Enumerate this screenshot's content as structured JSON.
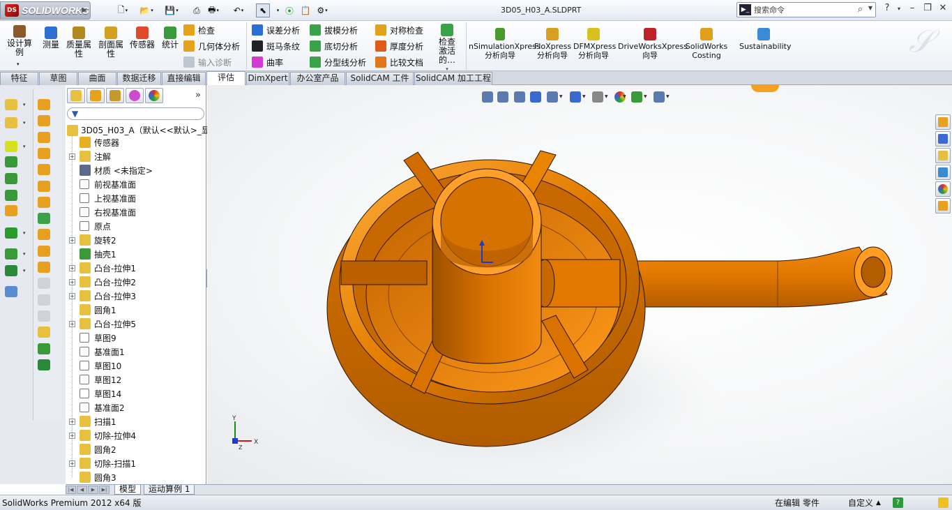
{
  "app": {
    "logo": "SOLIDWORKS",
    "file_title": "3D05_H03_A.SLDPRT"
  },
  "search": {
    "placeholder": "搜索命令"
  },
  "ribbon": {
    "big_buttons": [
      {
        "label": "设计算例",
        "icon": "design-study-icon",
        "color": "#8a5a2a"
      },
      {
        "label": "测量",
        "icon": "measure-icon",
        "color": "#2c6fd1"
      },
      {
        "label": "质量属性",
        "icon": "mass-properties-icon",
        "color": "#b08a1e"
      },
      {
        "label": "剖面属性",
        "icon": "section-properties-icon",
        "color": "#d4a020"
      },
      {
        "label": "传感器",
        "icon": "sensor-icon",
        "color": "#e04a2a"
      },
      {
        "label": "统计",
        "icon": "statistics-icon",
        "color": "#3a9a3a"
      }
    ],
    "small_col1": [
      {
        "label": "检查",
        "icon": "check-icon",
        "color": "#e6a21a"
      },
      {
        "label": "几何体分析",
        "icon": "geometry-analysis-icon",
        "color": "#e6a21a"
      },
      {
        "label": "输入诊断",
        "icon": "import-diagnostics-icon",
        "color": "#c0c6cf"
      }
    ],
    "small_col2": [
      {
        "label": "误差分析",
        "icon": "deviation-analysis-icon",
        "color": "#2a6ed8"
      },
      {
        "label": "斑马条纹",
        "icon": "zebra-stripes-icon",
        "color": "#222222"
      },
      {
        "label": "曲率",
        "icon": "curvature-icon",
        "color": "#d23ad4"
      }
    ],
    "small_col3": [
      {
        "label": "拔模分析",
        "icon": "draft-analysis-icon",
        "color": "#3aa34a"
      },
      {
        "label": "底切分析",
        "icon": "undercut-analysis-icon",
        "color": "#3aa34a"
      },
      {
        "label": "分型线分析",
        "icon": "parting-line-analysis-icon",
        "color": "#3aa34a"
      }
    ],
    "small_col4": [
      {
        "label": "对称检查",
        "icon": "symmetry-check-icon",
        "color": "#e0a31a"
      },
      {
        "label": "厚度分析",
        "icon": "thickness-analysis-icon",
        "color": "#e05a1a"
      },
      {
        "label": "比较文档",
        "icon": "compare-documents-icon",
        "color": "#e0781a"
      }
    ],
    "check_active": {
      "label": "检查激活的…",
      "icon": "check-active-icon"
    },
    "xpress": [
      {
        "label": "nSimulationXpress 分析向导",
        "icon": "simulationxpress-icon",
        "color": "#4a9a2a"
      },
      {
        "label": "FloXpress 分析向导",
        "icon": "floxpress-icon",
        "color": "#d8a020"
      },
      {
        "label": "DFMXpress 分析向导",
        "icon": "dfmxpress-icon",
        "color": "#d8c020"
      },
      {
        "label": "DriveWorksXpress 向导",
        "icon": "driveworksxpress-icon",
        "color": "#c0202a"
      },
      {
        "label": "SolidWorks Costing",
        "icon": "costing-icon",
        "color": "#e0a01a"
      },
      {
        "label": "Sustainability",
        "icon": "sustainability-icon",
        "color": "#3a8ad8"
      }
    ]
  },
  "tabs": [
    "特征",
    "草图",
    "曲面",
    "数据迁移",
    "直接编辑",
    "评估",
    "DimXpert",
    "办公室产品",
    "SolidCAM 工件",
    "SolidCAM 加工工程"
  ],
  "active_tab": "评估",
  "tree": {
    "root": "3D05_H03_A（默认<<默认>_显",
    "items": [
      {
        "label": "传感器",
        "icon": "sensor-icon",
        "expand": "",
        "color": "#e8b020"
      },
      {
        "label": "注解",
        "icon": "annotation-icon",
        "expand": "+",
        "color": "#e8c040"
      },
      {
        "label": "材质 <未指定>",
        "icon": "material-icon",
        "expand": "",
        "color": "#5a6a8a"
      },
      {
        "label": "前视基准面",
        "icon": "plane-icon",
        "expand": "",
        "color": "#ffffff"
      },
      {
        "label": "上视基准面",
        "icon": "plane-icon",
        "expand": "",
        "color": "#ffffff"
      },
      {
        "label": "右视基准面",
        "icon": "plane-icon",
        "expand": "",
        "color": "#ffffff"
      },
      {
        "label": "原点",
        "icon": "origin-icon",
        "expand": "",
        "color": "#ffffff"
      },
      {
        "label": "旋转2",
        "icon": "revolve-icon",
        "expand": "+",
        "color": "#e8c040"
      },
      {
        "label": "抽壳1",
        "icon": "shell-icon",
        "expand": "",
        "color": "#3a9a3a"
      },
      {
        "label": "凸台-拉伸1",
        "icon": "boss-extrude-icon",
        "expand": "+",
        "color": "#e8c040"
      },
      {
        "label": "凸台-拉伸2",
        "icon": "boss-extrude-icon",
        "expand": "+",
        "color": "#e8c040"
      },
      {
        "label": "凸台-拉伸3",
        "icon": "boss-extrude-icon",
        "expand": "+",
        "color": "#e8c040"
      },
      {
        "label": "圆角1",
        "icon": "fillet-icon",
        "expand": "",
        "color": "#e8c040"
      },
      {
        "label": "凸台-拉伸5",
        "icon": "boss-extrude-icon",
        "expand": "+",
        "color": "#e8c040"
      },
      {
        "label": "草图9",
        "icon": "sketch-icon",
        "expand": "",
        "color": "#ffffff"
      },
      {
        "label": "基准面1",
        "icon": "plane-icon",
        "expand": "",
        "color": "#ffffff"
      },
      {
        "label": "草图10",
        "icon": "sketch-icon",
        "expand": "",
        "color": "#ffffff"
      },
      {
        "label": "草图12",
        "icon": "sketch-icon",
        "expand": "",
        "color": "#ffffff"
      },
      {
        "label": "草图14",
        "icon": "sketch-icon",
        "expand": "",
        "color": "#ffffff"
      },
      {
        "label": "基准面2",
        "icon": "plane-icon",
        "expand": "",
        "color": "#ffffff"
      },
      {
        "label": "扫描1",
        "icon": "sweep-icon",
        "expand": "+",
        "color": "#e8c040"
      },
      {
        "label": "切除-拉伸4",
        "icon": "cut-extrude-icon",
        "expand": "+",
        "color": "#e8c040"
      },
      {
        "label": "圆角2",
        "icon": "fillet-icon",
        "expand": "",
        "color": "#e8c040"
      },
      {
        "label": "切除-扫描1",
        "icon": "cut-sweep-icon",
        "expand": "+",
        "color": "#e8c040"
      },
      {
        "label": "圆角3",
        "icon": "fillet-icon",
        "expand": "",
        "color": "#e8c040"
      }
    ]
  },
  "bottom_tabs": [
    "模型",
    "运动算例 1"
  ],
  "status": {
    "version": "SolidWorks Premium 2012 x64 版",
    "mode": "在编辑 零件",
    "units": "自定义"
  },
  "colors": {
    "model": "#e07a00",
    "model_dark": "#8a4300",
    "model_light": "#ffb24a"
  }
}
